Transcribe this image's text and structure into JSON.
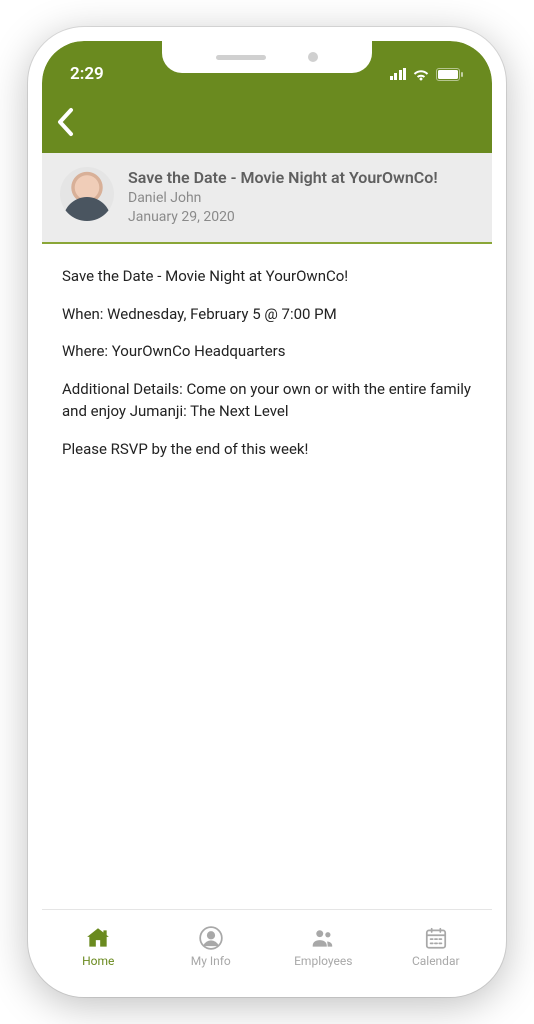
{
  "status": {
    "time": "2:29"
  },
  "post": {
    "title": "Save the Date - Movie Night at YourOwnCo!",
    "author": "Daniel John",
    "date": "January 29, 2020"
  },
  "body": {
    "line1": "Save the Date - Movie Night at YourOwnCo!",
    "when": "When: Wednesday, February 5 @ 7:00 PM",
    "where": "Where: YourOwnCo Headquarters",
    "details": "Additional Details: Come on your own or with the entire family and enjoy Jumanji: The Next Level",
    "rsvp": "Please RSVP by the end of this week!"
  },
  "tabs": {
    "home": "Home",
    "myinfo": "My Info",
    "employees": "Employees",
    "calendar": "Calendar"
  }
}
